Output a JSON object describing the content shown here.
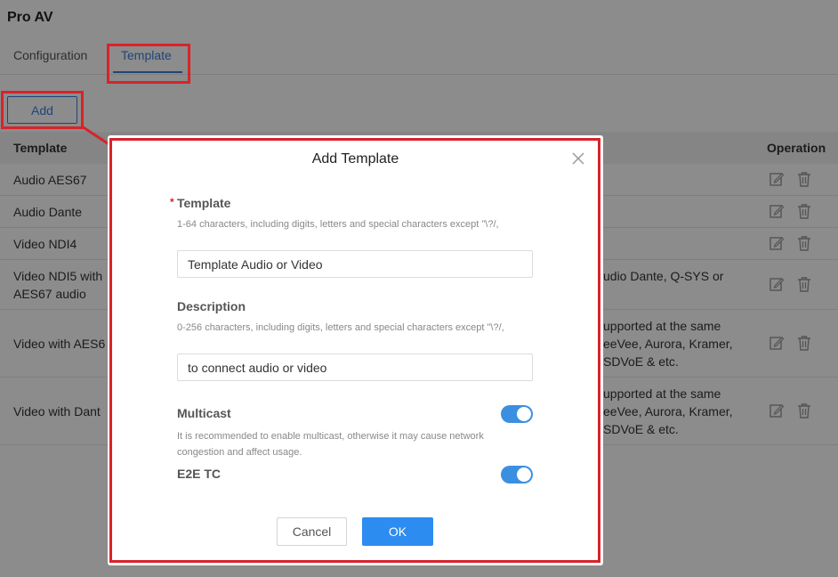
{
  "page": {
    "title": "Pro AV"
  },
  "tabs": {
    "configuration": "Configuration",
    "template": "Template"
  },
  "toolbar": {
    "add_label": "Add"
  },
  "table": {
    "headers": {
      "template": "Template",
      "operation": "Operation"
    },
    "rows": [
      {
        "name": "Audio AES67",
        "desc": ""
      },
      {
        "name": "Audio Dante",
        "desc": ""
      },
      {
        "name": "Video NDI4",
        "desc": ""
      },
      {
        "name": "Video NDI5 with AES67 audio",
        "desc": "udio Dante, Q-SYS or"
      },
      {
        "name": "Video with AES6",
        "desc": "upported at the same eeVee, Aurora, Kramer, SDVoE & etc."
      },
      {
        "name": "Video with Dant",
        "desc": "upported at the same eeVee, Aurora, Kramer, SDVoE & etc."
      }
    ]
  },
  "modal": {
    "title": "Add Template",
    "template_field": {
      "required_mark": "*",
      "label": "Template",
      "hint": "1-64 characters, including digits, letters and special characters except \"\\?/,",
      "value": "Template Audio or Video"
    },
    "description_field": {
      "label": "Description",
      "hint": "0-256 characters, including digits, letters and special characters except \"\\?/,",
      "value": "to connect audio or video"
    },
    "multicast": {
      "label": "Multicast",
      "hint": "It is recommended to enable multicast, otherwise it may cause network congestion and affect usage.",
      "enabled": true
    },
    "e2e_tc": {
      "label": "E2E TC",
      "enabled": true
    },
    "cancel_label": "Cancel",
    "ok_label": "OK"
  },
  "colors": {
    "accent": "#3b7dd8",
    "primary_button": "#2d8cf0",
    "toggle_on": "#3b8fe0",
    "highlight": "#d8232a"
  },
  "icons": {
    "close": "close-icon",
    "edit": "edit-icon",
    "delete": "trash-icon"
  }
}
